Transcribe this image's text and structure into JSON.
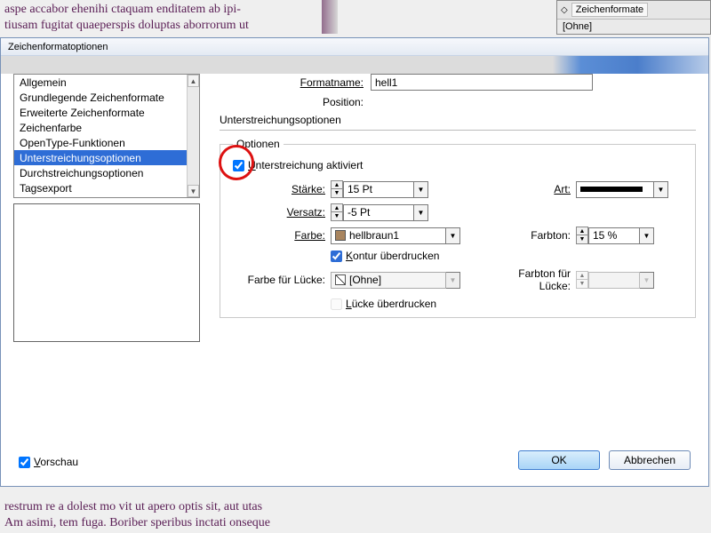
{
  "bg_text": {
    "top": "aspe accabor ehenihi ctaquam enditatem ab ipi-\ntiusam fugitat quaeperspis doluptas aborrorum ut",
    "bottom": "restrum re a dolest mo vit ut apero optis sit, aut utas\nAm asimi, tem fuga. Boriber speribus inctati onseque"
  },
  "panel": {
    "tab": "Zeichenformate",
    "none": "[Ohne]"
  },
  "dialog": {
    "title": "Zeichenformatoptionen",
    "sidebar_items": [
      "Allgemein",
      "Grundlegende Zeichenformate",
      "Erweiterte Zeichenformate",
      "Zeichenfarbe",
      "OpenType-Funktionen",
      "Unterstreichungsoptionen",
      "Durchstreichungsoptionen",
      "Tagsexport"
    ],
    "selected_index": 5,
    "formatname_label": "Formatname:",
    "formatname_value": "hell1",
    "position_label": "Position:",
    "section_title": "Unterstreichungsoptionen",
    "fieldset_legend": "Optionen",
    "activate_label": "Unterstreichung aktiviert",
    "activate_checked": true,
    "staerke_label": "Stärke:",
    "staerke_value": "15 Pt",
    "art_label": "Art:",
    "versatz_label": "Versatz:",
    "versatz_value": "-5 Pt",
    "farbe_label": "Farbe:",
    "farbe_value": "hellbraun1",
    "farbton_label": "Farbton:",
    "farbton_value": "15 %",
    "kontur_label": "Kontur überdrucken",
    "kontur_checked": true,
    "luecke_farbe_label": "Farbe für Lücke:",
    "luecke_farbe_value": "[Ohne]",
    "luecke_ton_label": "Farbton für Lücke:",
    "luecke_ton_value": "",
    "luecke_ueber_label": "Lücke überdrucken",
    "luecke_ueber_checked": false,
    "vorschau_label": "Vorschau",
    "vorschau_checked": true,
    "ok": "OK",
    "cancel": "Abbrechen"
  }
}
